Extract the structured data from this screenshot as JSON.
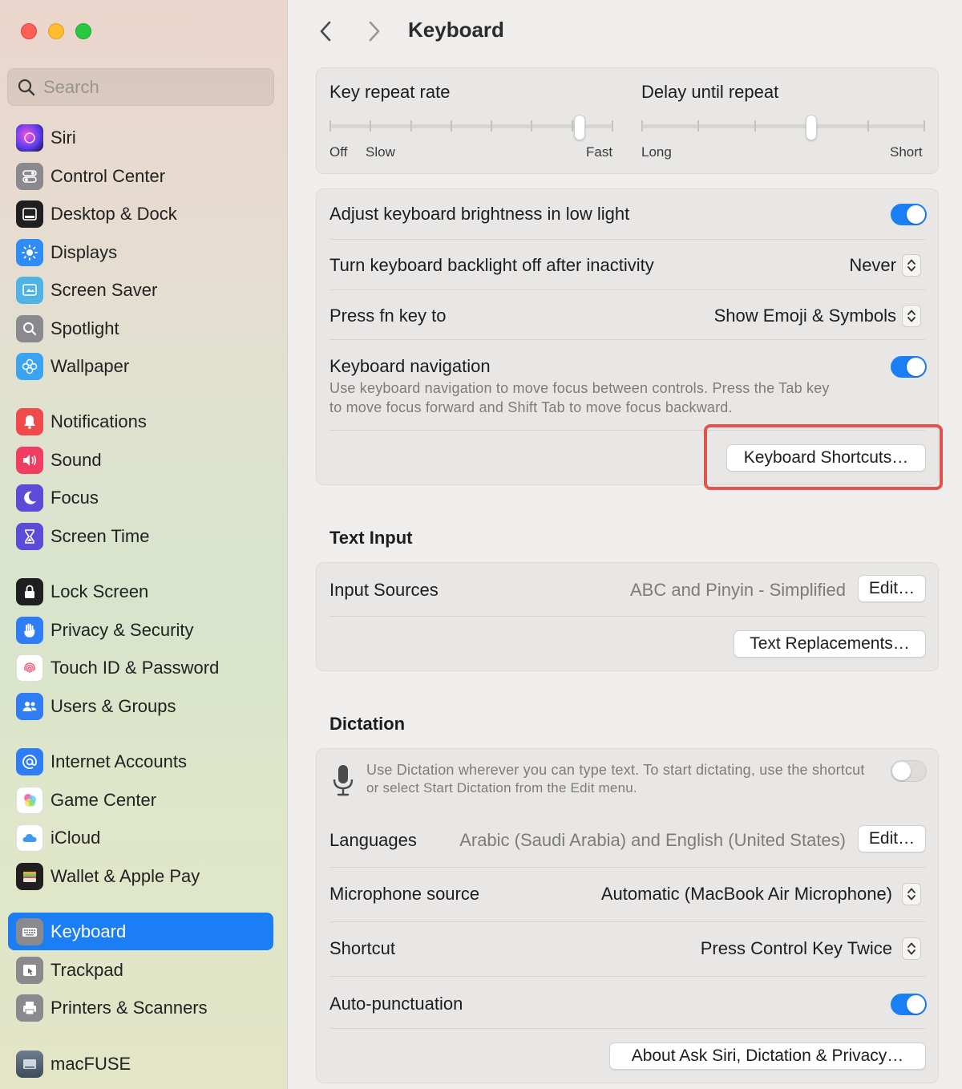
{
  "window": {
    "title": "Keyboard"
  },
  "sidebar": {
    "search_placeholder": "Search",
    "items": [
      {
        "label": "Siri",
        "icon": "siri-icon",
        "color": "#6a4cd8"
      },
      {
        "label": "Control Center",
        "icon": "control-center-icon",
        "color": "#8a8a8e"
      },
      {
        "label": "Desktop & Dock",
        "icon": "dock-icon",
        "color": "#1f1f1f"
      },
      {
        "label": "Displays",
        "icon": "sun-icon",
        "color": "#2f8cf6"
      },
      {
        "label": "Screen Saver",
        "icon": "screen-saver-icon",
        "color": "#4fb3e6"
      },
      {
        "label": "Spotlight",
        "icon": "magnifier-icon",
        "color": "#8a8a8e"
      },
      {
        "label": "Wallpaper",
        "icon": "flower-icon",
        "color": "#3aa4f0"
      },
      {
        "label": "Notifications",
        "icon": "bell-icon",
        "color": "#f24a4a"
      },
      {
        "label": "Sound",
        "icon": "speaker-icon",
        "color": "#f23d62"
      },
      {
        "label": "Focus",
        "icon": "moon-icon",
        "color": "#5b4bd6"
      },
      {
        "label": "Screen Time",
        "icon": "hourglass-icon",
        "color": "#5b4bd6"
      },
      {
        "label": "Lock Screen",
        "icon": "lock-icon",
        "color": "#1f1f1f"
      },
      {
        "label": "Privacy & Security",
        "icon": "hand-icon",
        "color": "#2f7df6"
      },
      {
        "label": "Touch ID & Password",
        "icon": "fingerprint-icon",
        "color": "#ffffff"
      },
      {
        "label": "Users & Groups",
        "icon": "users-icon",
        "color": "#2f7df6"
      },
      {
        "label": "Internet Accounts",
        "icon": "at-icon",
        "color": "#2f7df6"
      },
      {
        "label": "Game Center",
        "icon": "game-center-icon",
        "color": "#ffffff"
      },
      {
        "label": "iCloud",
        "icon": "cloud-icon",
        "color": "#ffffff"
      },
      {
        "label": "Wallet & Apple Pay",
        "icon": "wallet-icon",
        "color": "#1f1f1f"
      },
      {
        "label": "Keyboard",
        "icon": "keyboard-icon",
        "color": "#8a8a8e",
        "selected": true
      },
      {
        "label": "Trackpad",
        "icon": "trackpad-icon",
        "color": "#8a8a8e"
      },
      {
        "label": "Printers & Scanners",
        "icon": "printer-icon",
        "color": "#8a8a8e"
      },
      {
        "label": "macFUSE",
        "icon": "macfuse-icon",
        "color": "#5a6a7a"
      }
    ]
  },
  "main": {
    "title": "Keyboard",
    "repeat": {
      "key_repeat_label": "Key repeat rate",
      "key_repeat_min_label": "Off",
      "key_repeat_slow_label": "Slow",
      "key_repeat_max_label": "Fast",
      "key_repeat_level": 0.88,
      "delay_label": "Delay until repeat",
      "delay_min_label": "Long",
      "delay_max_label": "Short",
      "delay_level": 0.6
    },
    "settings": {
      "brightness_label": "Adjust keyboard brightness in low light",
      "brightness_on": true,
      "backlight_label": "Turn keyboard backlight off after inactivity",
      "backlight_value": "Never",
      "fn_label": "Press fn key to",
      "fn_value": "Show Emoji & Symbols",
      "nav_label": "Keyboard navigation",
      "nav_on": true,
      "nav_desc_line1": "Use keyboard navigation to move focus between controls. Press the Tab key",
      "nav_desc_line2": "to move focus forward and Shift Tab to move focus backward.",
      "shortcuts_button": "Keyboard Shortcuts…"
    },
    "text_input": {
      "section_title": "Text Input",
      "input_sources_label": "Input Sources",
      "input_sources_value": "ABC and Pinyin - Simplified",
      "edit_button": "Edit…",
      "replacements_button": "Text Replacements…"
    },
    "dictation": {
      "section_title": "Dictation",
      "desc_line1": "Use Dictation wherever you can type text. To start dictating, use the shortcut",
      "desc_line2": "or select Start Dictation from the Edit menu.",
      "dictation_on": false,
      "languages_label": "Languages",
      "languages_value": "Arabic (Saudi Arabia) and English (United States)",
      "languages_edit": "Edit…",
      "mic_label": "Microphone source",
      "mic_value": "Automatic (MacBook Air Microphone)",
      "shortcut_label": "Shortcut",
      "shortcut_value": "Press Control Key Twice",
      "autopunct_label": "Auto-punctuation",
      "autopunct_on": true,
      "about_button": "About Ask Siri, Dictation & Privacy…"
    }
  },
  "colors": {
    "accent": "#1c7ef4",
    "highlight": "#e2534a"
  }
}
